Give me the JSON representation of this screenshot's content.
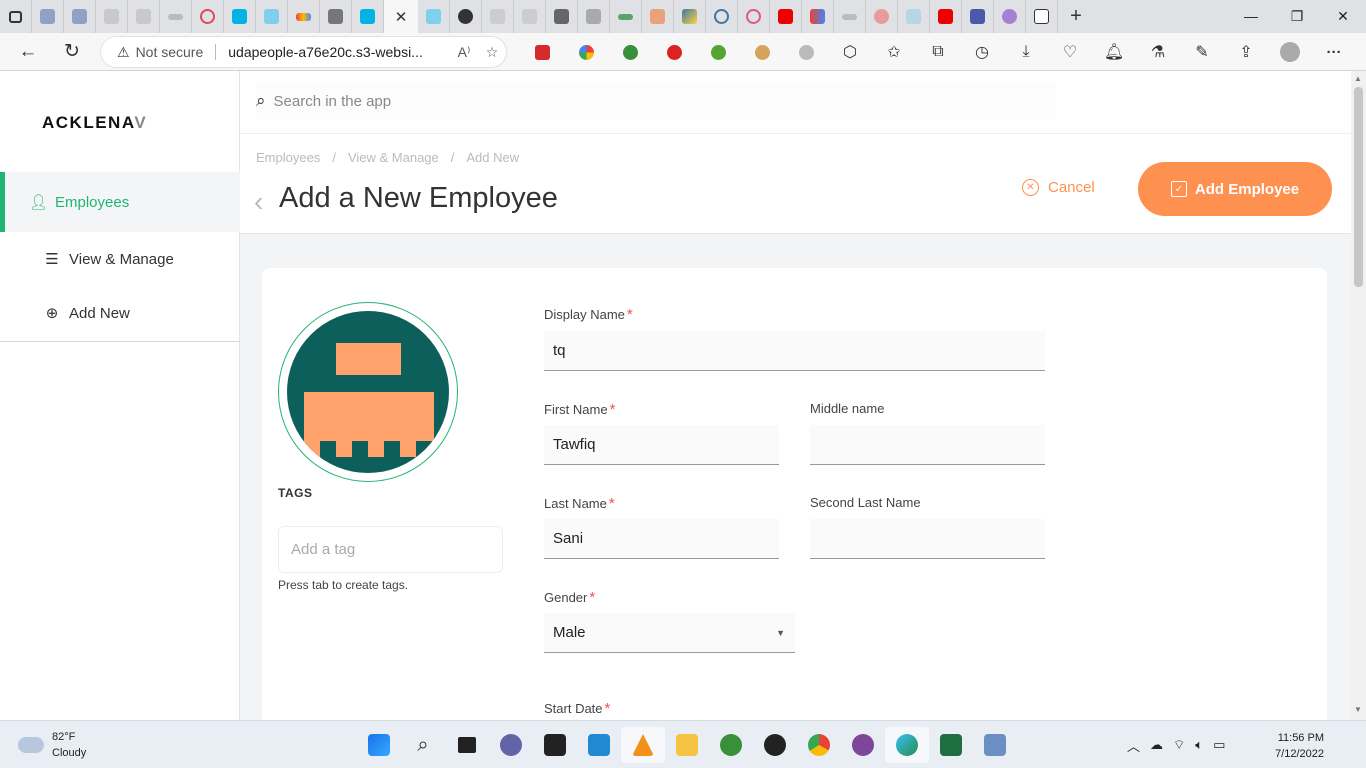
{
  "browser": {
    "tab_close_glyph": "✕",
    "new_tab_glyph": "+",
    "not_secure": "Not secure",
    "url": "udapeople-a76e20c.s3-websi...",
    "read_aloud": "A⁾",
    "win_min": "—",
    "win_max": "❐",
    "win_close": "✕",
    "more_glyph": "···"
  },
  "app": {
    "logo_main": "ACKLENA",
    "logo_fade": "V",
    "search_placeholder": "Search in the app",
    "sidebar": [
      {
        "label": "Employees",
        "icon": "user-icon"
      },
      {
        "label": "View & Manage",
        "icon": "list-icon"
      },
      {
        "label": "Add New",
        "icon": "plus-circle-icon"
      }
    ],
    "breadcrumb": [
      "Employees",
      "View & Manage",
      "Add New"
    ],
    "breadcrumb_sep": "/",
    "page_title": "Add a New Employee",
    "cancel_label": "Cancel",
    "add_label": "Add Employee"
  },
  "form": {
    "tags_title": "TAGS",
    "tag_placeholder": "Add a tag",
    "tag_hint": "Press tab to create tags.",
    "required_mark": "*",
    "display_name": {
      "label": "Display Name",
      "value": "tq"
    },
    "first_name": {
      "label": "First Name",
      "value": "Tawfiq"
    },
    "middle_name": {
      "label": "Middle name",
      "value": ""
    },
    "last_name": {
      "label": "Last Name",
      "value": "Sani"
    },
    "second_last_name": {
      "label": "Second Last Name",
      "value": ""
    },
    "gender": {
      "label": "Gender",
      "value": "Male"
    },
    "start_date": {
      "label": "Start Date"
    }
  },
  "taskbar": {
    "temp": "82°F",
    "condition": "Cloudy",
    "time": "11:56 PM",
    "date": "7/12/2022"
  },
  "colors": {
    "accent_green": "#21b573",
    "accent_orange": "#ff9150",
    "avatar_bg": "#0d5f5b",
    "avatar_fg": "#ffa26b"
  }
}
